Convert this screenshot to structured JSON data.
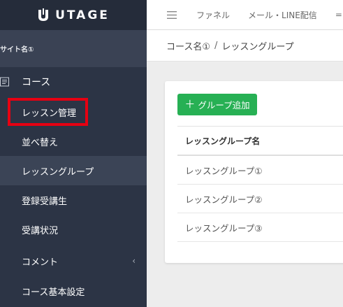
{
  "app": {
    "logo_text": "UTAGE"
  },
  "sidebar": {
    "site_name": "サイト名①",
    "course_label": "コース",
    "items": [
      {
        "label": "レッスン管理"
      },
      {
        "label": "並べ替え"
      },
      {
        "label": "レッスングループ"
      },
      {
        "label": "登録受講生"
      },
      {
        "label": "受講状況"
      },
      {
        "label": "コメント",
        "chevron": "‹"
      },
      {
        "label": "コース基本設定"
      }
    ],
    "active_item": "レッスングループ",
    "highlighted_item": "レッスン管理"
  },
  "topnav": {
    "links": [
      "ファネル",
      "メール・LINE配信"
    ],
    "more": "="
  },
  "breadcrumb": {
    "course": "コース名①",
    "separator": "/",
    "current": "レッスングループ"
  },
  "main": {
    "add_button": {
      "plus": "＋",
      "label": "グループ追加"
    },
    "table": {
      "header": "レッスングループ名",
      "rows": [
        "レッスングループ①",
        "レッスングループ②",
        "レッスングループ③"
      ]
    }
  },
  "colors": {
    "sidebar_bg": "#2c3445",
    "accent_green": "#27b054",
    "highlight_red": "#e60012"
  }
}
